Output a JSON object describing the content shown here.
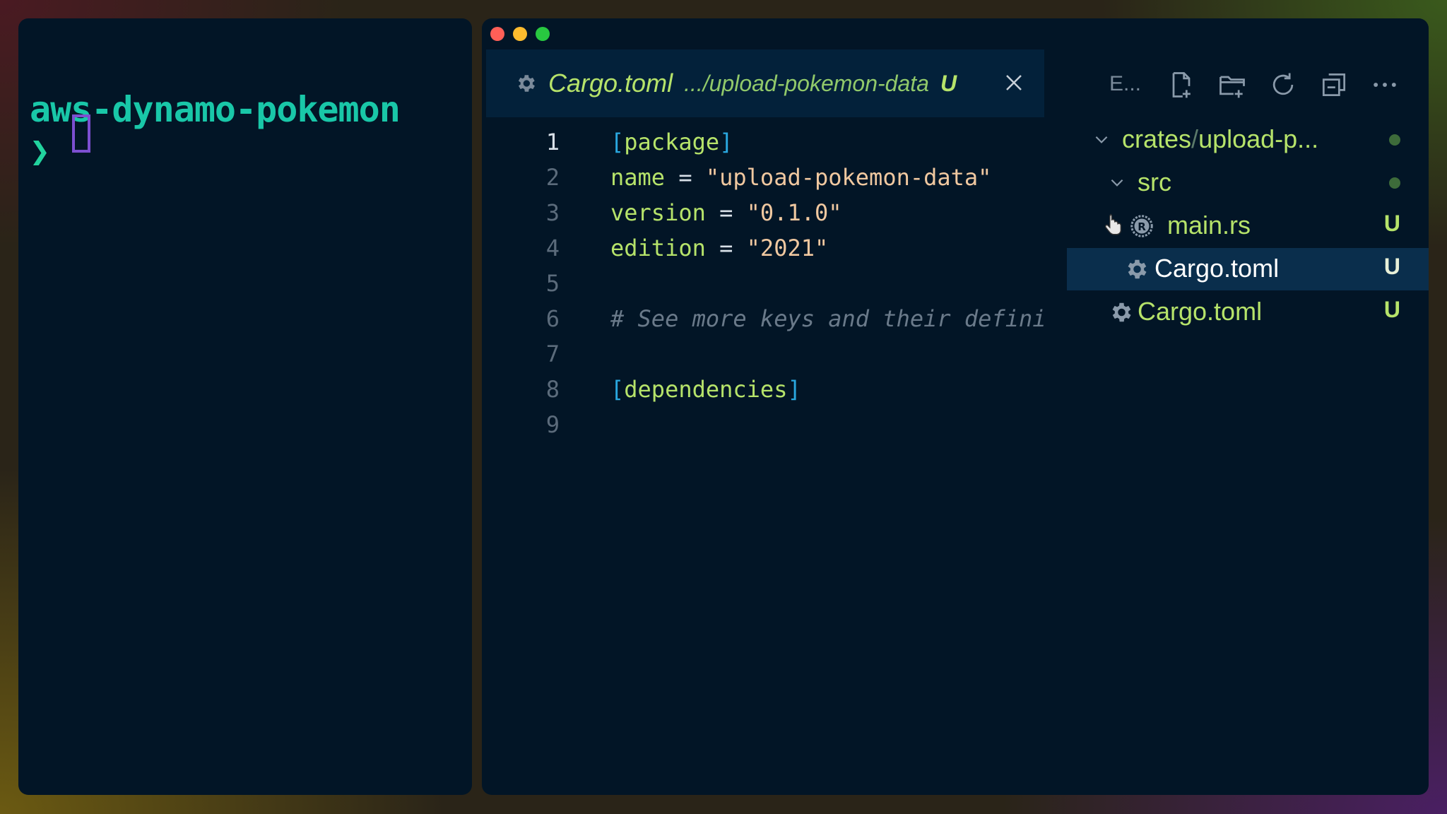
{
  "terminal": {
    "title": "aws-dynamo-pokemon",
    "prompt_symbol": "❯"
  },
  "editor": {
    "tab": {
      "filename": "Cargo.toml",
      "path": ".../upload-pokemon-data",
      "badge": "U",
      "icon": "gear-icon"
    },
    "lines": [
      {
        "num": "1",
        "bracket_open": "[",
        "section": "package",
        "bracket_close": "]"
      },
      {
        "num": "2",
        "key": "name",
        "op": " = ",
        "value": "\"upload-pokemon-data\""
      },
      {
        "num": "3",
        "key": "version",
        "op": " = ",
        "value": "\"0.1.0\""
      },
      {
        "num": "4",
        "key": "edition",
        "op": " = ",
        "value": "\"2021\""
      },
      {
        "num": "5"
      },
      {
        "num": "6",
        "comment": "# See more keys and their defini"
      },
      {
        "num": "7"
      },
      {
        "num": "8",
        "bracket_open": "[",
        "section": "dependencies",
        "bracket_close": "]"
      },
      {
        "num": "9"
      }
    ],
    "explorer": {
      "title": "E...",
      "toolbar_icons": [
        "new-file-icon",
        "new-folder-icon",
        "refresh-icon",
        "collapse-all-icon",
        "more-icon"
      ],
      "tree": [
        {
          "label_a": "crates",
          "sep": "/",
          "label_b": "upload-p...",
          "status": "dot"
        },
        {
          "label": "src",
          "status": "dot"
        },
        {
          "label": "main.rs",
          "badge": "U",
          "icon": "rust-icon"
        },
        {
          "label": "Cargo.toml",
          "badge": "U",
          "icon": "gear-icon"
        },
        {
          "label": "Cargo.toml",
          "badge": "U",
          "icon": "gear-icon"
        }
      ]
    }
  },
  "colors": {
    "panel_bg": "#021526",
    "accent_green": "#b6e36a",
    "terminal_title": "#19c7a8",
    "bracket_blue": "#2aa8e0",
    "string": "#f0c8a0",
    "cursor_purple": "#7c4fd0"
  }
}
